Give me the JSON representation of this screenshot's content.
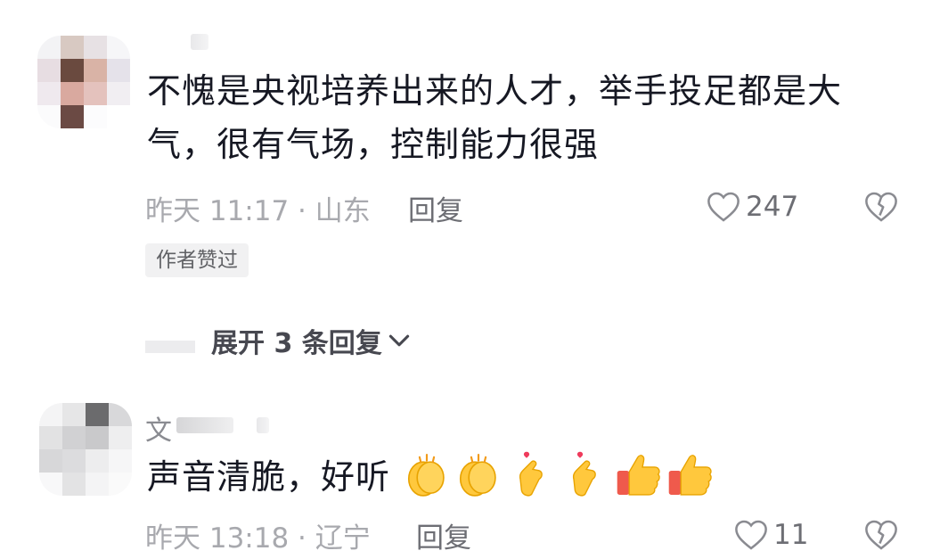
{
  "comments": [
    {
      "text_line1": "不愧是央视培养出来的人才，举手投足都是大",
      "text_line2": "气，很有气场，控制能力很强",
      "time": "昨天 11:17",
      "location": "山东",
      "reply_label": "回复",
      "likes": "247",
      "badge": "作者赞过",
      "expand_label": "展开 3 条回复"
    },
    {
      "username": "文",
      "text": "声音清脆，好听",
      "emojis": [
        "clap",
        "clap",
        "finger-heart",
        "finger-heart",
        "thumbs-up",
        "thumbs-up"
      ],
      "time": "昨天 13:18",
      "location": "辽宁",
      "reply_label": "回复",
      "likes": "11"
    }
  ],
  "icons": {
    "like": "heart-outline-icon",
    "dislike": "broken-heart-icon",
    "expand": "chevron-down-icon"
  }
}
